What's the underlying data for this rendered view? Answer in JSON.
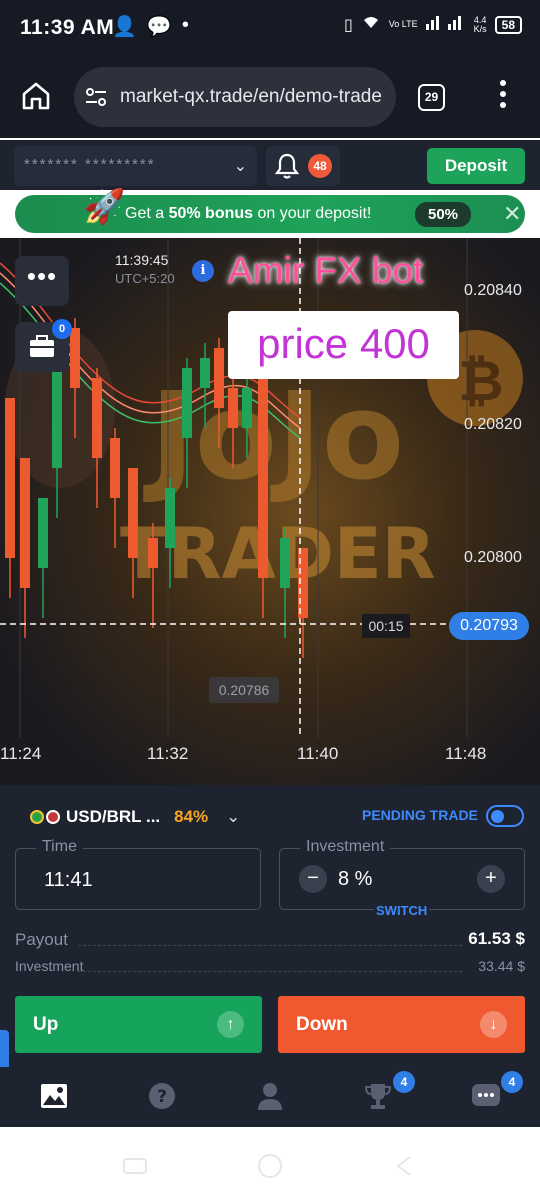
{
  "status_bar": {
    "time": "11:39 AM",
    "network": "Vo LTE",
    "speed_top": "4.4",
    "speed_bottom": "K/s",
    "battery": "58"
  },
  "browser": {
    "url": "market-qx.trade/en/demo-trade",
    "tab_count": "29"
  },
  "topbar": {
    "account_masked": "******* *********",
    "notification_count": "48",
    "deposit_label": "Deposit"
  },
  "banner": {
    "text_prefix": "Get a ",
    "text_bold": "50% bonus",
    "text_suffix": " on your deposit!",
    "badge": "50%"
  },
  "chart": {
    "clock": "11:39:45",
    "timezone": "UTC+5:20",
    "overlay_title": "Amir FX bot",
    "overlay_price": "price 400",
    "countdown": "00:15",
    "current_price": "0.20793",
    "min_price": "0.20786",
    "briefcase_badge": "0",
    "price_ticks": [
      "0.20840",
      "0.20820",
      "0.20800"
    ],
    "time_ticks": [
      "11:24",
      "11:32",
      "11:40",
      "11:48"
    ]
  },
  "trade": {
    "pair": "USD/BRL ...",
    "payout_pct": "84%",
    "pending_label": "PENDING TRADE",
    "time_label": "Time",
    "time_value": "11:41",
    "investment_label": "Investment",
    "investment_value": "8 %",
    "switch_label": "SWITCH",
    "payout_label": "Payout",
    "payout_value": "61.53 $",
    "investment_row_label": "Investment",
    "investment_row_value": "33.44 $",
    "up_label": "Up",
    "down_label": "Down"
  },
  "bottom_nav": {
    "trophy_badge": "4",
    "chat_badge": "4"
  },
  "colors": {
    "up": "#16a35b",
    "down": "#f0582f",
    "accent": "#2f7fe6",
    "deposit": "#1ea35a"
  }
}
